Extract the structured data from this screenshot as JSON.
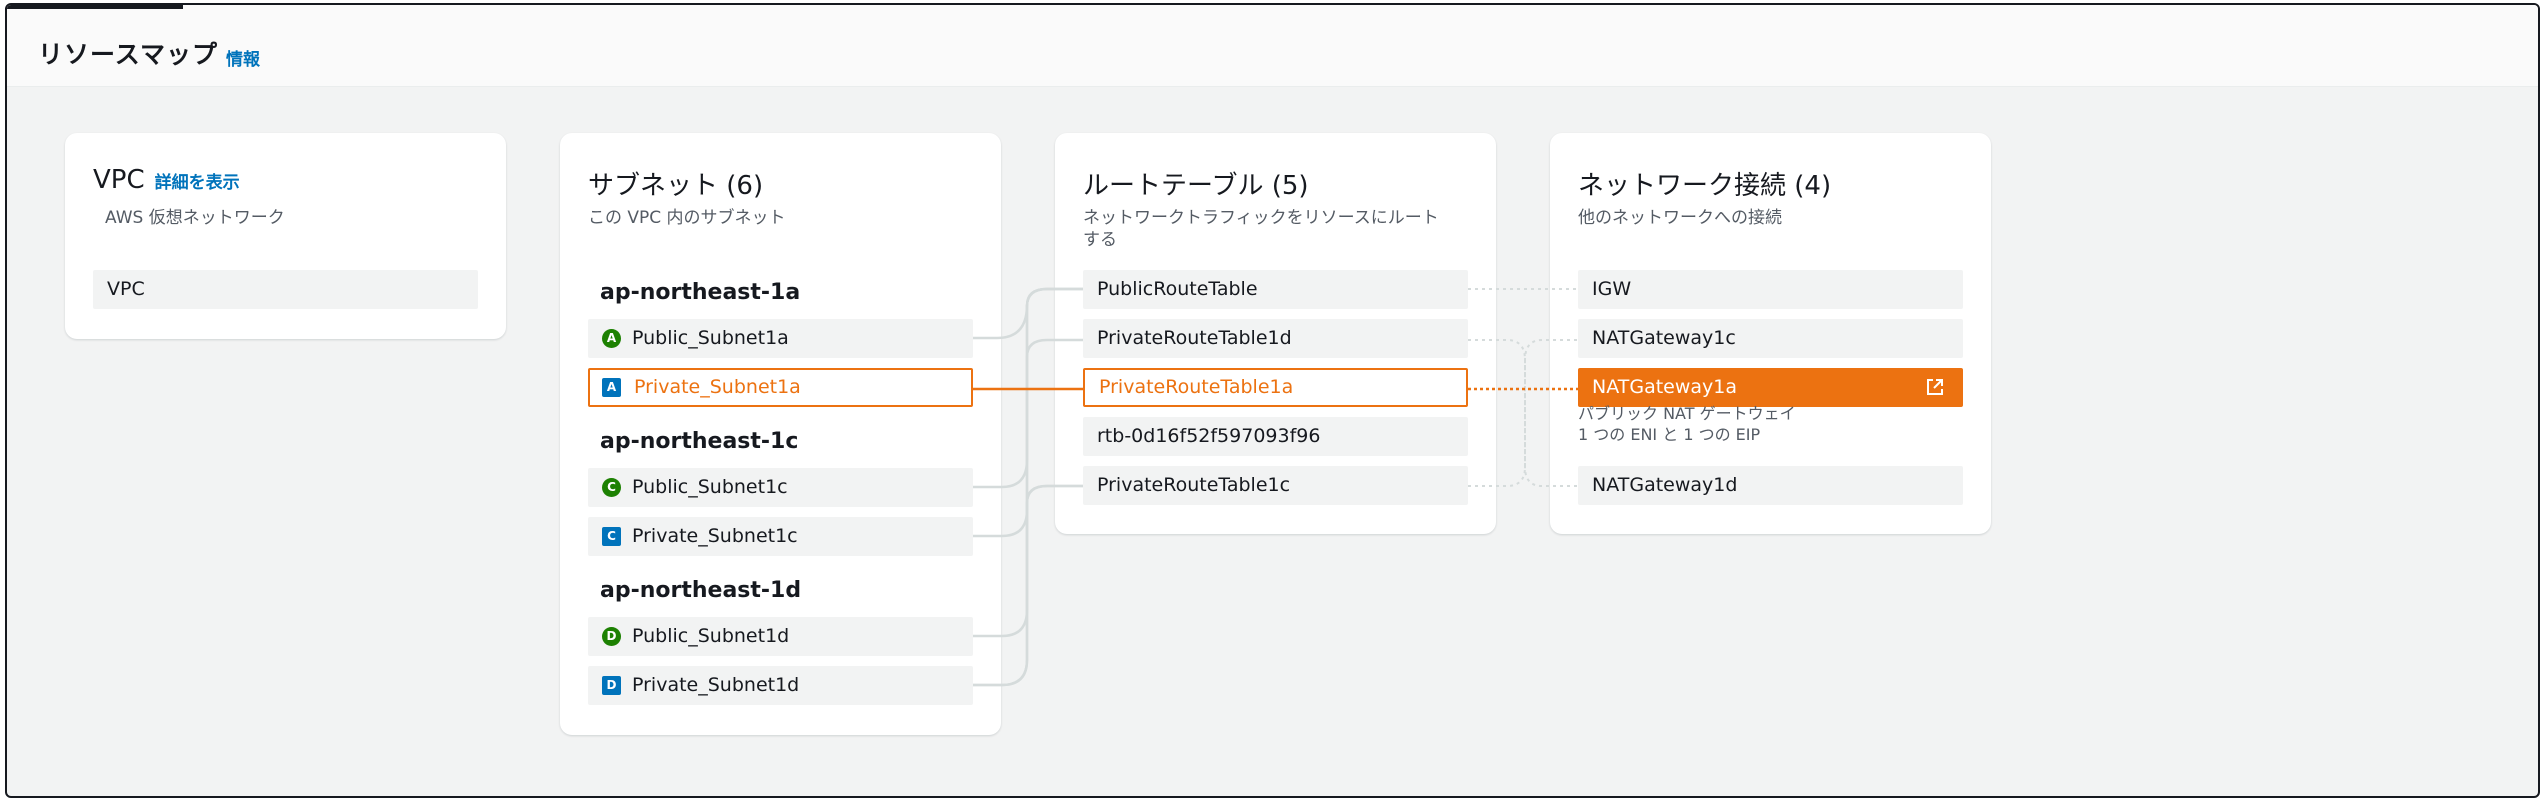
{
  "header": {
    "title": "リソースマップ",
    "info_link": "情報"
  },
  "vpc_card": {
    "title": "VPC",
    "detail_link": "詳細を表示",
    "subtitle": "AWS 仮想ネットワーク",
    "item": "VPC"
  },
  "subnet_card": {
    "title": "サブネット (6)",
    "subtitle": "この VPC 内のサブネット",
    "zones": [
      {
        "name": "ap-northeast-1a",
        "subnets": [
          {
            "badge": "A",
            "label": "Public_Subnet1a",
            "type": "public"
          },
          {
            "badge": "A",
            "label": "Private_Subnet1a",
            "type": "private"
          }
        ]
      },
      {
        "name": "ap-northeast-1c",
        "subnets": [
          {
            "badge": "C",
            "label": "Public_Subnet1c",
            "type": "public"
          },
          {
            "badge": "C",
            "label": "Private_Subnet1c",
            "type": "private"
          }
        ]
      },
      {
        "name": "ap-northeast-1d",
        "subnets": [
          {
            "badge": "D",
            "label": "Public_Subnet1d",
            "type": "public"
          },
          {
            "badge": "D",
            "label": "Private_Subnet1d",
            "type": "private"
          }
        ]
      }
    ]
  },
  "route_card": {
    "title": "ルートテーブル (5)",
    "subtitle_line1": "ネットワークトラフィックをリソースにルート",
    "subtitle_line2": "する",
    "tables": [
      "PublicRouteTable",
      "PrivateRouteTable1d",
      "PrivateRouteTable1a",
      "rtb-0d16f52f597093f96",
      "PrivateRouteTable1c"
    ]
  },
  "network_card": {
    "title": "ネットワーク接続 (4)",
    "subtitle": "他のネットワークへの接続",
    "connections": [
      "IGW",
      "NATGateway1c",
      "NATGateway1a",
      "NATGateway1d"
    ],
    "selected_desc_line1": "パブリック NAT ゲートウェイ",
    "selected_desc_line2": "1 つの ENI と 1 つの EIP"
  },
  "colors": {
    "accent": "#ec7211",
    "link": "#0073bb",
    "public_badge": "#1d8102",
    "private_badge": "#0073bb"
  },
  "icons": {
    "external_link": "external-link-icon"
  }
}
